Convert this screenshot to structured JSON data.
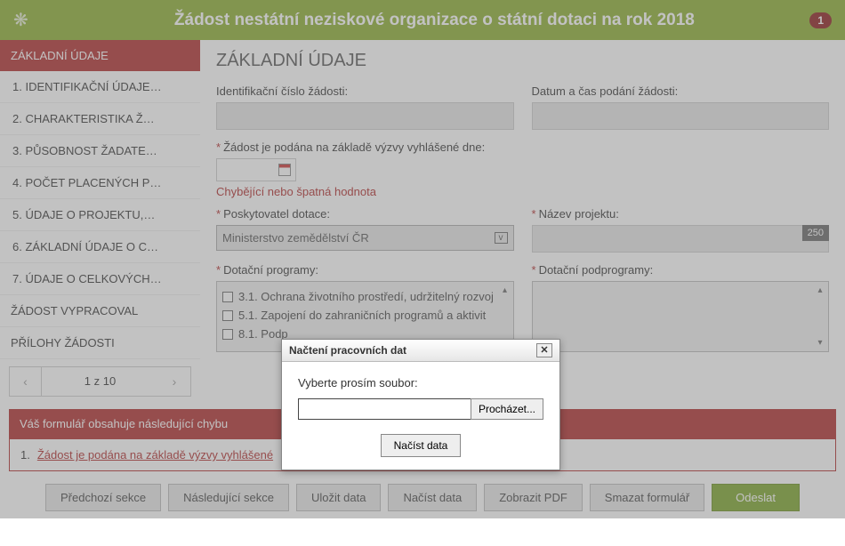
{
  "header": {
    "title": "Žádost nestátní neziskové organizace o státní dotaci na rok 2018",
    "badge": "1"
  },
  "sidebar": {
    "header": "ZÁKLADNÍ ÚDAJE",
    "items": [
      "1. IDENTIFIKAČNÍ ÚDAJE…",
      "2. CHARAKTERISTIKA Ž…",
      "3. PŮSOBNOST ŽADATE…",
      "4. POČET PLACENÝCH P…",
      "5. ÚDAJE O PROJEKTU,…",
      "6. ZÁKLADNÍ ÚDAJE O C…",
      "7. ÚDAJE O CELKOVÝCH…"
    ],
    "sections": [
      "ŽÁDOST VYPRACOVAL",
      "PŘÍLOHY ŽÁDOSTI"
    ],
    "pager": {
      "prev": "‹",
      "label": "1 z 10",
      "next": "›"
    }
  },
  "main": {
    "title": "ZÁKLADNÍ ÚDAJE",
    "id_label": "Identifikační číslo žádosti:",
    "id_value": "",
    "date_label": "Datum a čas podání žádosti:",
    "date_value": "",
    "vyzva_label": "Žádost je podána na základě výzvy vyhlášené dne:",
    "vyzva_error": "Chybějící nebo špatná hodnota",
    "poskytovatel_label": "Poskytovatel dotace:",
    "poskytovatel_value": "Ministerstvo zemědělství ČR",
    "nazev_label": "Název projektu:",
    "nazev_counter": "250",
    "programy_label": "Dotační programy:",
    "programy_items": [
      "3.1. Ochrana životního prostředí, udržitelný rozvoj",
      "5.1. Zapojení do zahraničních programů a aktivit",
      "8.1. Podp"
    ],
    "podprogramy_label": "Dotační podprogramy:"
  },
  "errors": {
    "header": "Váš formulář obsahuje následující chybu",
    "num": "1.",
    "link": "Žádost je podána na základě výzvy vyhlášené"
  },
  "footer": {
    "prev": "Předchozí sekce",
    "next": "Následující sekce",
    "save": "Uložit data",
    "load": "Načíst data",
    "pdf": "Zobrazit PDF",
    "clear": "Smazat formulář",
    "send": "Odeslat"
  },
  "modal": {
    "title": "Načtení pracovních dat",
    "close": "✕",
    "label": "Vyberte prosím soubor:",
    "browse": "Procházet...",
    "action": "Načíst data"
  }
}
